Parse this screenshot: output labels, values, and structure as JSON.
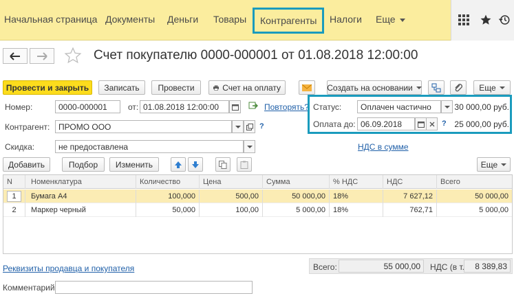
{
  "nav": {
    "items": [
      "Начальная страница",
      "Документы",
      "Деньги",
      "Товары",
      "Контрагенты",
      "Налоги",
      "Еще"
    ],
    "active": "Контрагенты"
  },
  "title": "Счет покупателю 0000-000001 от 01.08.2018 12:00:00",
  "toolbar": {
    "post_close": "Провести и закрыть",
    "save": "Записать",
    "post": "Провести",
    "print_invoice": "Счет на оплату",
    "create_based": "Создать на основании",
    "more": "Еще"
  },
  "form": {
    "number_label": "Номер:",
    "number": "0000-000001",
    "date_label": "от:",
    "date": "01.08.2018 12:00:00",
    "repeat_link": "Повторять?",
    "counterparty_label": "Контрагент:",
    "counterparty": "ПРОМО ООО",
    "discount_label": "Скидка:",
    "discount": "не предоставлена",
    "status_label": "Статус:",
    "status": "Оплачен частично",
    "status_amount": "30 000,00 руб.",
    "due_label": "Оплата до:",
    "due_date": "06.09.2018",
    "due_amount": "25 000,00 руб.",
    "vat_link": "НДС в сумме",
    "help": "?"
  },
  "table_toolbar": {
    "add": "Добавить",
    "pick": "Подбор",
    "edit": "Изменить",
    "more": "Еще"
  },
  "table": {
    "headers": [
      "N",
      "Номенклатура",
      "Количество",
      "Цена",
      "Сумма",
      "% НДС",
      "НДС",
      "Всего"
    ],
    "rows": [
      [
        "1",
        "Бумага А4",
        "100,000",
        "500,00",
        "50 000,00",
        "18%",
        "7 627,12",
        "50 000,00"
      ],
      [
        "2",
        "Маркер черный",
        "50,000",
        "100,00",
        "5 000,00",
        "18%",
        "762,71",
        "5 000,00"
      ]
    ]
  },
  "footer": {
    "requisites_link": "Реквизиты продавца и покупателя",
    "total_label": "Всего:",
    "total": "55 000,00",
    "vat_label": "НДС (в т.ч.):",
    "vat": "8 389,83",
    "comment_label": "Комментарий:",
    "comment": ""
  },
  "colors": {
    "nav_bg": "#fbed9e",
    "primary": "#fcdc1d",
    "highlight": "#1a9bbd",
    "selected_row": "#fbecb4",
    "link": "#1f5fa8"
  }
}
